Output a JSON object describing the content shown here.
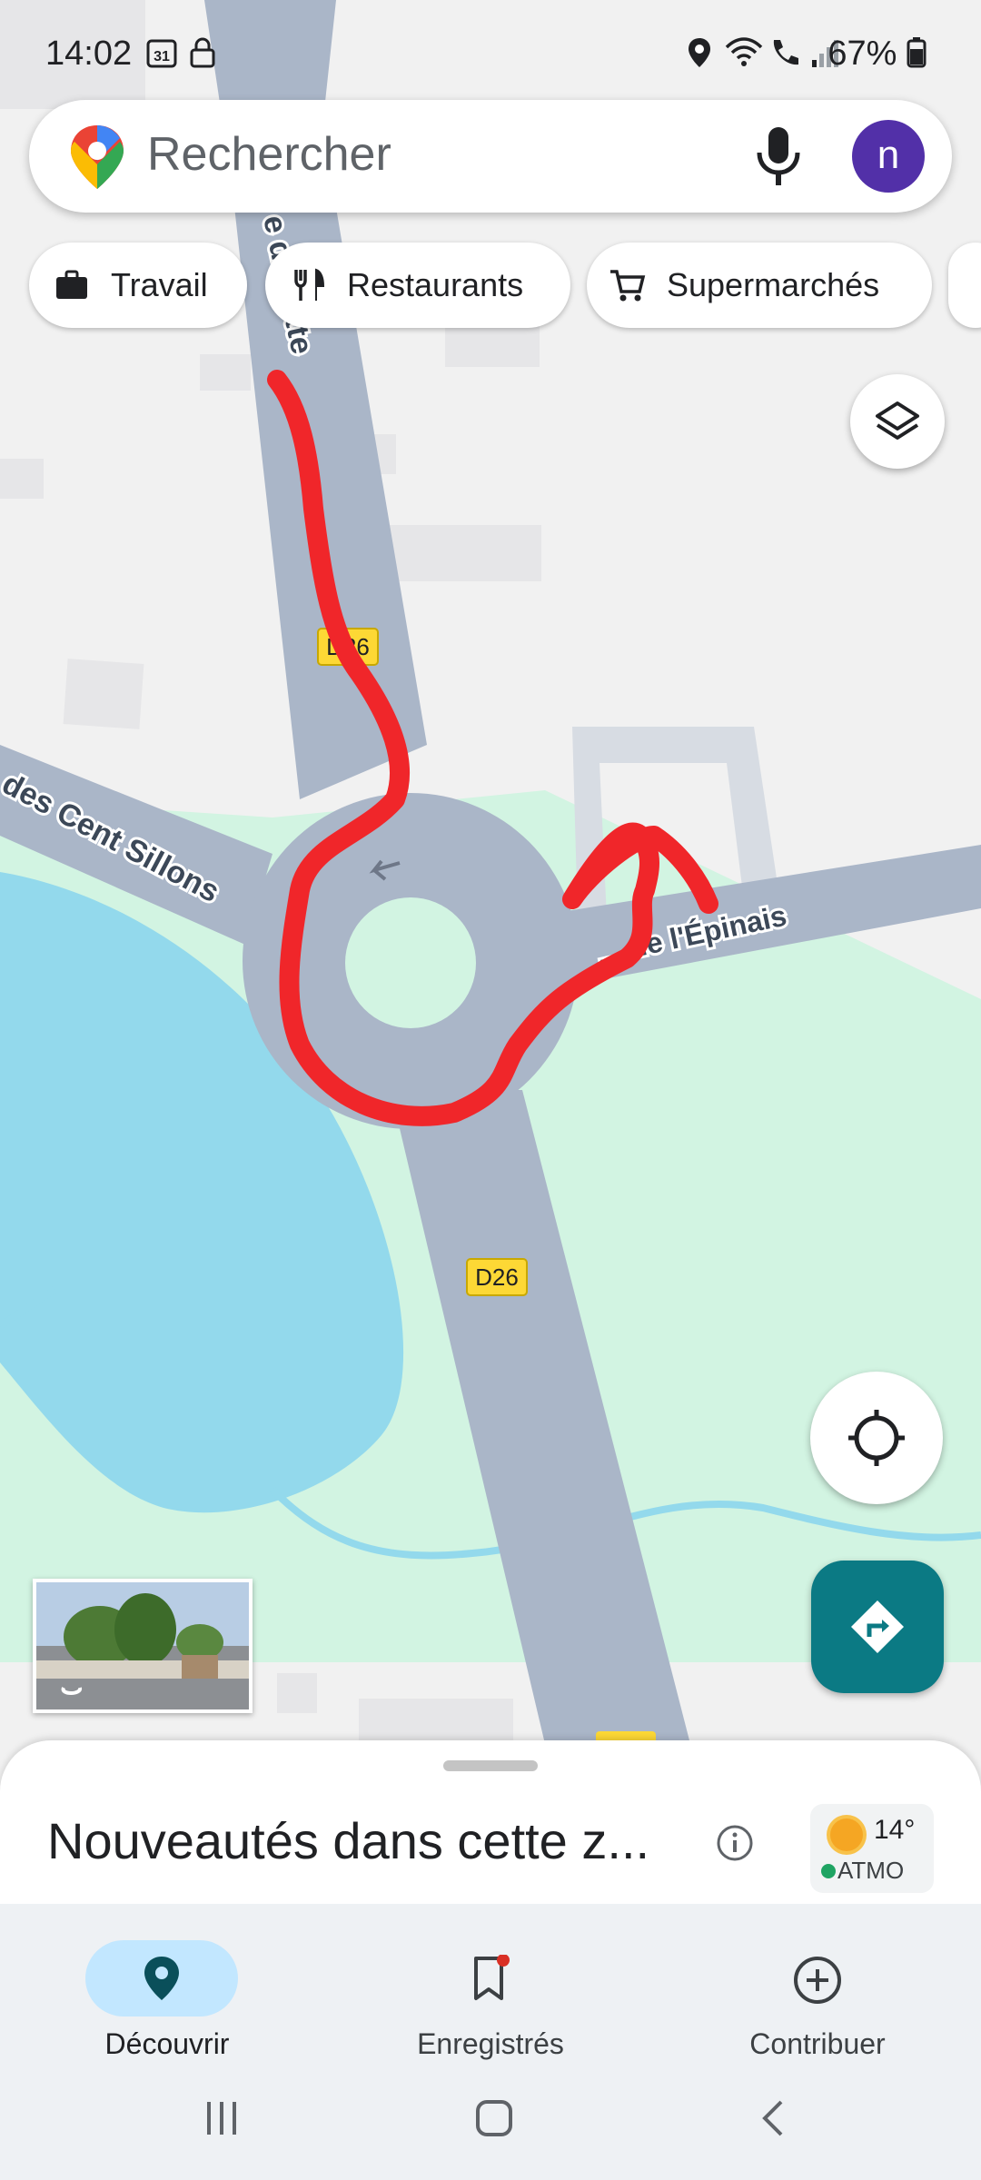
{
  "status_bar": {
    "time": "14:02",
    "calendar_day": "31",
    "battery": "67%",
    "icons": [
      "calendar-icon",
      "lock-icon",
      "location-icon",
      "wifi-icon",
      "wifi-call-icon",
      "signal-icon",
      "battery-icon"
    ]
  },
  "search": {
    "placeholder": "Rechercher",
    "avatar_initial": "n"
  },
  "chips": [
    {
      "label": "Travail",
      "icon": "briefcase-icon"
    },
    {
      "label": "Restaurants",
      "icon": "fork-knife-icon"
    },
    {
      "label": "Supermarchés",
      "icon": "cart-icon"
    }
  ],
  "map": {
    "road_labels": {
      "left_street": "des Cent Sillons",
      "top_street": "e d. Butte",
      "right_street": "... de l'Épinais",
      "shield_top": "D26",
      "shield_bottom": "D26"
    },
    "colors": {
      "road": "#aab6c8",
      "water": "#93d9ec",
      "park": "#d2f4e2",
      "background": "#f1f1f1",
      "annotation": "#f0262a"
    }
  },
  "bottom_sheet": {
    "title": "Nouveautés dans cette z...",
    "weather_temp": "14°",
    "air_quality_label": "ATMO"
  },
  "bottom_nav": [
    {
      "label": "Découvrir",
      "icon": "location-pin-icon",
      "selected": true
    },
    {
      "label": "Enregistrés",
      "icon": "bookmark-icon",
      "selected": false
    },
    {
      "label": "Contribuer",
      "icon": "plus-circle-icon",
      "selected": false
    }
  ],
  "accent_colors": {
    "selected_nav_bg": "#c2e7ff",
    "directions_button": "#0b7a84",
    "avatar": "#5230a8"
  }
}
